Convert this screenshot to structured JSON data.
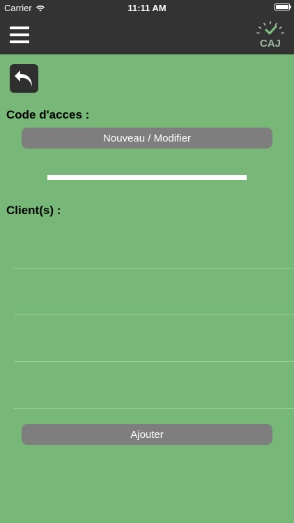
{
  "status_bar": {
    "carrier": "Carrier",
    "time": "11:11 AM",
    "battery_level": 1.0,
    "wifi_icon": "wifi-icon",
    "battery_icon": "battery-icon"
  },
  "nav_bar": {
    "menu_icon": "hamburger-menu-icon",
    "logo_text": "CAJ",
    "background_color": "#333333"
  },
  "back_button": {
    "icon": "undo-arrow-icon"
  },
  "access_code": {
    "label": "Code d'acces :",
    "button_label": "Nouveau / Modifier",
    "code_value": ""
  },
  "clients": {
    "label": "Client(s) :",
    "rows": [
      "",
      "",
      "",
      ""
    ],
    "add_button_label": "Ajouter"
  },
  "colors": {
    "background": "#77b777",
    "bar": "#333333",
    "button": "#7e7e7e",
    "logo_green": "#7fc47f"
  }
}
